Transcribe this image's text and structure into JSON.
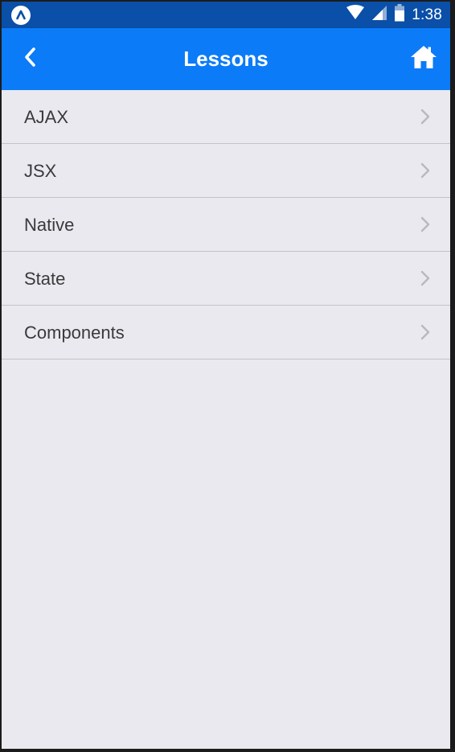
{
  "status_bar": {
    "time": "1:38",
    "app_icon": "react-native-icon",
    "icons": [
      "wifi-icon",
      "signal-icon",
      "battery-icon"
    ]
  },
  "header": {
    "title": "Lessons",
    "back_icon": "chevron-left-icon",
    "home_icon": "home-icon"
  },
  "lessons": [
    {
      "label": "AJAX"
    },
    {
      "label": "JSX"
    },
    {
      "label": "Native"
    },
    {
      "label": "State"
    },
    {
      "label": "Components"
    }
  ],
  "colors": {
    "status_bar": "#0a4fa8",
    "header": "#0b7bf8",
    "background": "#e9e9ef",
    "divider": "#c3c3c8",
    "chevron": "#b8b8be"
  }
}
